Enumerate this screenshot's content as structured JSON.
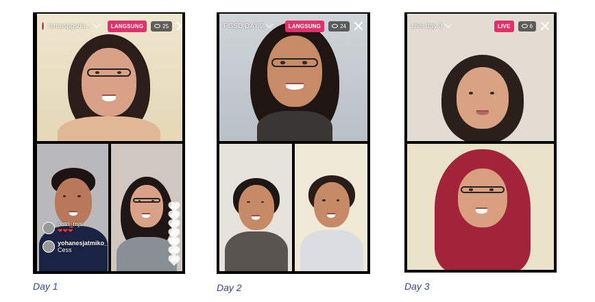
{
  "day1": {
    "caption": "Day 1",
    "account_name": "himpspgsdu...",
    "live_label": "LANGSUNG",
    "viewer_count": "25",
    "comments": [
      {
        "user": "putri_mjs",
        "text": "❤❤❤"
      },
      {
        "user": "yohanesjatmiko_",
        "text": "Cess"
      }
    ]
  },
  "day2": {
    "caption": "Day 2",
    "title": "PGSD DAY 2",
    "live_label": "LANGSUNG",
    "viewer_count": "24"
  },
  "day3": {
    "caption": "Day 3",
    "title": "Live day 3",
    "live_label": "LIVE",
    "viewer_count": "6"
  },
  "colors": {
    "live_badge": "#e1306c",
    "caption_text": "#2f4a7a",
    "panel_bg": "#000000"
  },
  "icons": [
    "chevron-down-icon",
    "eye-icon",
    "close-icon",
    "heart-icon"
  ]
}
